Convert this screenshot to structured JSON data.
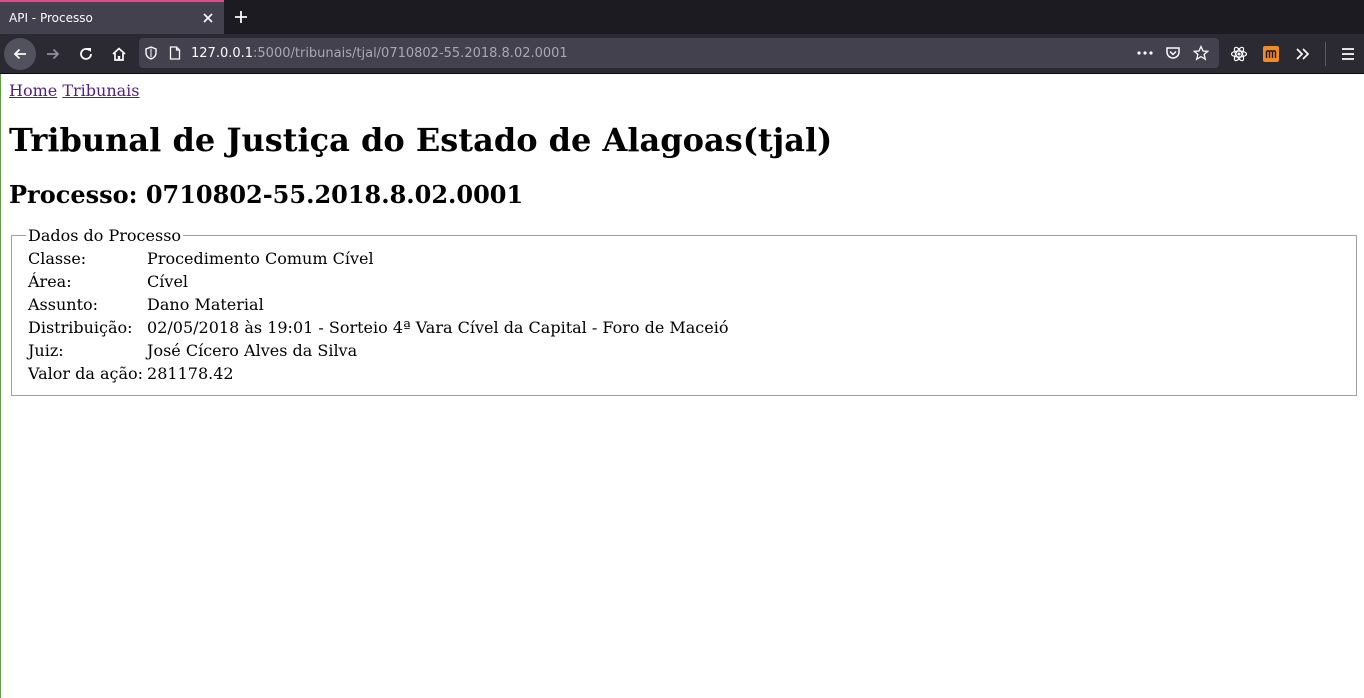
{
  "browser": {
    "tab_title": "API - Processo",
    "url_host": "127.0.0.1",
    "url_path": ":5000/tribunais/tjal/0710802-55.2018.8.02.0001",
    "icons": [
      "back-icon",
      "forward-icon",
      "reload-icon",
      "home-icon",
      "shield-icon",
      "page-icon",
      "more-icon",
      "pocket-icon",
      "bookmark-star-icon",
      "react-devtools-icon",
      "extension-m-icon",
      "overflow-icon",
      "menu-icon"
    ]
  },
  "nav": {
    "home": "Home",
    "tribunais": "Tribunais"
  },
  "heading": {
    "tribunal": "Tribunal de Justiça do Estado de Alagoas(tjal)",
    "processo": "Processo: 0710802-55.2018.8.02.0001"
  },
  "dados": {
    "legend": "Dados do Processo",
    "rows": [
      {
        "label": "Classe:",
        "value": "Procedimento Comum Cível"
      },
      {
        "label": "Área:",
        "value": "Cível"
      },
      {
        "label": "Assunto:",
        "value": "Dano Material"
      },
      {
        "label": "Distribuição:",
        "value": "02/05/2018 às 19:01 - Sorteio 4ª Vara Cível da Capital - Foro de Maceió"
      },
      {
        "label": "Juiz:",
        "value": "José Cícero Alves da Silva"
      },
      {
        "label": "Valor da ação:",
        "value": "281178.42"
      }
    ]
  },
  "colors": {
    "tab_accent": "#e14b8a",
    "link_visited": "#551a8b",
    "extension_accent": "#f08a24"
  }
}
